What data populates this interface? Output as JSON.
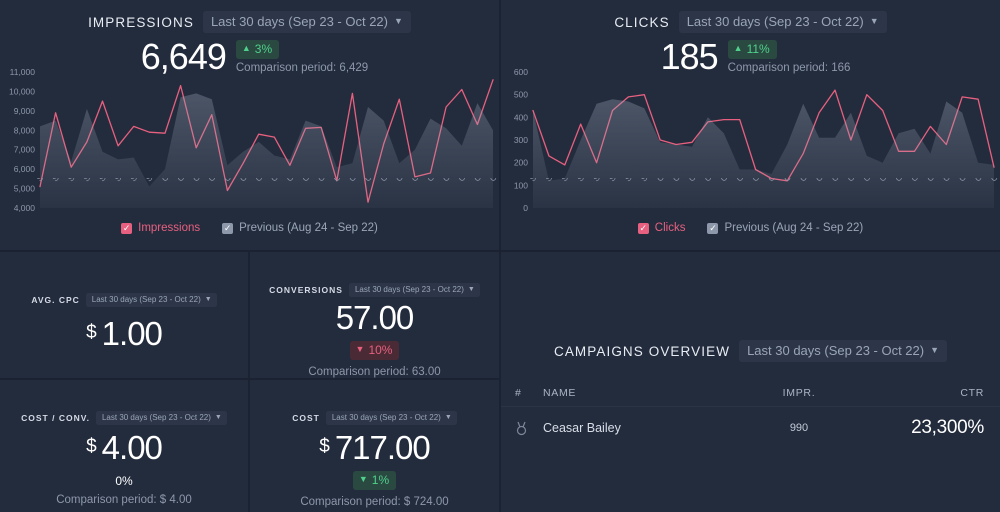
{
  "theme": {
    "bg": "#232c3d",
    "divider": "#1b2232",
    "accent_pink": "#e8607f",
    "accent_green": "#4fd18b",
    "accent_red": "#e8607f",
    "muted_text": "#8d98ab",
    "previous_series": "#8d98ab"
  },
  "impressions_panel": {
    "title": "IMPRESSIONS",
    "date_range": "Last 30 days (Sep 23 - Oct 22)",
    "chevron": "⌄",
    "value": "6,649",
    "delta": "3%",
    "delta_direction": "up",
    "delta_arrow": "▲",
    "comparison": "Comparison period: 6,429",
    "legend": [
      {
        "label": "Impressions",
        "color": "pink",
        "checked": true,
        "check": "✓"
      },
      {
        "label": "Previous (Aug 24 - Sep 22)",
        "color": "gray",
        "checked": true,
        "check": "✓"
      }
    ]
  },
  "clicks_panel": {
    "title": "CLICKS",
    "date_range": "Last 30 days (Sep 23 - Oct 22)",
    "chevron": "⌄",
    "value": "185",
    "delta": "11%",
    "delta_direction": "up",
    "delta_arrow": "▲",
    "comparison": "Comparison period: 166",
    "legend": [
      {
        "label": "Clicks",
        "color": "pink",
        "checked": true,
        "check": "✓"
      },
      {
        "label": "Previous (Aug 24 - Sep 22)",
        "color": "gray",
        "checked": true,
        "check": "✓"
      }
    ]
  },
  "cards": {
    "avg_cpc": {
      "title": "AVG. CPC",
      "date_range": "Last 30 days (Sep 23 - Oct 22)",
      "chevron": "⌄",
      "currency": "$",
      "value": "1.00"
    },
    "conversions": {
      "title": "CONVERSIONS",
      "date_range": "Last 30 days (Sep 23 - Oct 22)",
      "chevron": "⌄",
      "currency": "",
      "value": "57.00",
      "delta": "10%",
      "delta_direction": "down",
      "delta_arrow": "▼",
      "comparison": "Comparison period: 63.00"
    },
    "cost_conv": {
      "title": "COST / CONV.",
      "date_range": "Last 30 days (Sep 23 - Oct 22)",
      "chevron": "⌄",
      "currency": "$",
      "value": "4.00",
      "delta": "0%",
      "delta_direction": "flat",
      "comparison": "Comparison period: $ 4.00"
    },
    "cost": {
      "title": "COST",
      "date_range": "Last 30 days (Sep 23 - Oct 22)",
      "chevron": "⌄",
      "currency": "$",
      "value": "717.00",
      "delta": "1%",
      "delta_direction": "down-good",
      "delta_arrow": "▼",
      "comparison": "Comparison period: $ 724.00"
    }
  },
  "campaigns": {
    "title": "CAMPAIGNS OVERVIEW",
    "date_range": "Last 30 days (Sep 23 - Oct 22)",
    "chevron": "⌄",
    "columns": [
      "#",
      "NAME",
      "IMPR.",
      "CTR"
    ],
    "rows": [
      {
        "rank_icon": "medal-icon",
        "name": "Ceasar Bailey",
        "impressions": "990",
        "ctr": "23,300%"
      }
    ]
  },
  "chart_data": [
    {
      "type": "area",
      "id": "impressions",
      "title": "IMPRESSIONS",
      "xlabel": "",
      "ylabel": "",
      "ylim": [
        4000,
        11000
      ],
      "yticks": [
        11000,
        10000,
        9000,
        8000,
        7000,
        6000,
        5000,
        4000
      ],
      "ytick_labels": [
        "11,000",
        "10,000",
        "9,000",
        "8,000",
        "7,000",
        "6,000",
        "5,000",
        "4,000"
      ],
      "grid": false,
      "legend_position": "bottom",
      "x": [
        "Sep 23",
        "Sep 24",
        "Sep 25",
        "Sep 26",
        "Sep 27",
        "Sep 28",
        "Sep 29",
        "Sep 30",
        "Oct 1",
        "Oct 2",
        "Oct 3",
        "Oct 4",
        "Oct 5",
        "Oct 6",
        "Oct 7",
        "Oct 8",
        "Oct 9",
        "Oct 10",
        "Oct 11",
        "Oct 12",
        "Oct 13",
        "Oct 14",
        "Oct 15",
        "Oct 16",
        "Oct 17",
        "Oct 18",
        "Oct 19",
        "Oct 20",
        "Oct 21",
        "Oct 22"
      ],
      "series": [
        {
          "name": "Impressions",
          "style": "line",
          "color": "#e8607f",
          "values": [
            5100,
            8900,
            6100,
            7400,
            9500,
            7200,
            8200,
            7900,
            7850,
            10300,
            7100,
            8800,
            4900,
            6300,
            7800,
            7650,
            6200,
            8100,
            8150,
            5400,
            9900,
            4300,
            7300,
            9600,
            5600,
            5800,
            9200,
            10100,
            8300,
            10600
          ]
        },
        {
          "name": "Previous (Aug 24 - Sep 22)",
          "style": "area",
          "color": "#8d98ab",
          "values": [
            8200,
            8500,
            6400,
            9100,
            6900,
            6500,
            6600,
            5100,
            6000,
            9700,
            9900,
            9600,
            6200,
            6900,
            7400,
            6700,
            6500,
            8500,
            8200,
            6100,
            6300,
            9200,
            8500,
            6300,
            7000,
            8600,
            8100,
            7200,
            9400,
            8000
          ]
        }
      ]
    },
    {
      "type": "area",
      "id": "clicks",
      "title": "CLICKS",
      "xlabel": "",
      "ylabel": "",
      "ylim": [
        0,
        600
      ],
      "yticks": [
        600,
        500,
        400,
        300,
        200,
        100,
        0
      ],
      "ytick_labels": [
        "600",
        "500",
        "400",
        "300",
        "200",
        "100",
        "0"
      ],
      "grid": false,
      "legend_position": "bottom",
      "x": [
        "Sep 23",
        "Sep 24",
        "Sep 25",
        "Sep 26",
        "Sep 27",
        "Sep 28",
        "Sep 29",
        "Sep 30",
        "Oct 1",
        "Oct 2",
        "Oct 3",
        "Oct 4",
        "Oct 5",
        "Oct 6",
        "Oct 7",
        "Oct 8",
        "Oct 9",
        "Oct 10",
        "Oct 11",
        "Oct 12",
        "Oct 13",
        "Oct 14",
        "Oct 15",
        "Oct 16",
        "Oct 17",
        "Oct 18",
        "Oct 19",
        "Oct 20",
        "Oct 21",
        "Oct 22"
      ],
      "series": [
        {
          "name": "Clicks",
          "style": "line",
          "color": "#e8607f",
          "values": [
            430,
            230,
            190,
            370,
            200,
            430,
            490,
            500,
            300,
            280,
            290,
            380,
            390,
            390,
            170,
            130,
            120,
            240,
            420,
            520,
            300,
            500,
            430,
            250,
            250,
            360,
            280,
            490,
            480,
            180
          ]
        },
        {
          "name": "Previous (Aug 24 - Sep 22)",
          "style": "area",
          "color": "#8d98ab",
          "values": [
            430,
            120,
            130,
            300,
            460,
            480,
            470,
            440,
            290,
            280,
            270,
            400,
            330,
            170,
            170,
            150,
            280,
            460,
            310,
            310,
            420,
            230,
            200,
            330,
            350,
            240,
            470,
            420,
            200,
            190
          ]
        }
      ]
    }
  ]
}
